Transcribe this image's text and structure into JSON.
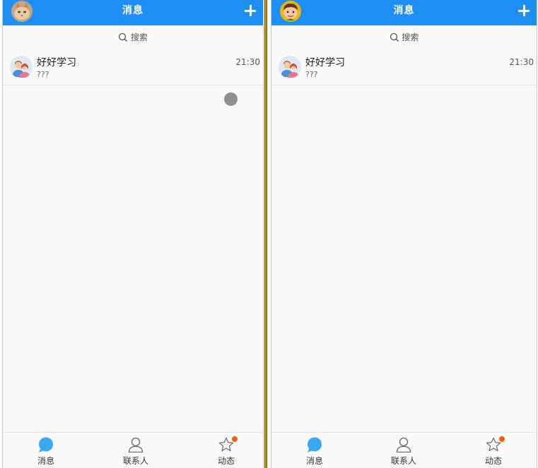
{
  "colors": {
    "header": "#1e90f5",
    "active_tab_icon": "#3aa9f2",
    "badge": "#ff5a00",
    "typing_dot": "#8e8e93"
  },
  "left": {
    "header": {
      "title": "消息",
      "avatar_icon": "cat-avatar-icon",
      "add_icon": "plus-icon"
    },
    "search": {
      "label": "搜索",
      "icon": "search-icon"
    },
    "conversations": [
      {
        "name": "好好学习",
        "preview": "???",
        "time": "21:30",
        "avatar_icon": "group-avatar-icon"
      }
    ],
    "tabs": [
      {
        "label": "消息",
        "icon": "chat-bubble-icon",
        "active": true
      },
      {
        "label": "联系人",
        "icon": "person-icon",
        "active": false
      },
      {
        "label": "动态",
        "icon": "star-icon",
        "active": false,
        "badge": true
      }
    ]
  },
  "right": {
    "header": {
      "title": "消息",
      "avatar_icon": "boy-avatar-icon",
      "add_icon": "plus-icon"
    },
    "search": {
      "label": "搜索",
      "icon": "search-icon"
    },
    "conversations": [
      {
        "name": "好好学习",
        "preview": "???",
        "time": "21:30",
        "avatar_icon": "group-avatar-icon"
      }
    ],
    "tabs": [
      {
        "label": "消息",
        "icon": "chat-bubble-icon",
        "active": true
      },
      {
        "label": "联系人",
        "icon": "person-icon",
        "active": false
      },
      {
        "label": "动态",
        "icon": "star-icon",
        "active": false,
        "badge": true
      }
    ]
  }
}
